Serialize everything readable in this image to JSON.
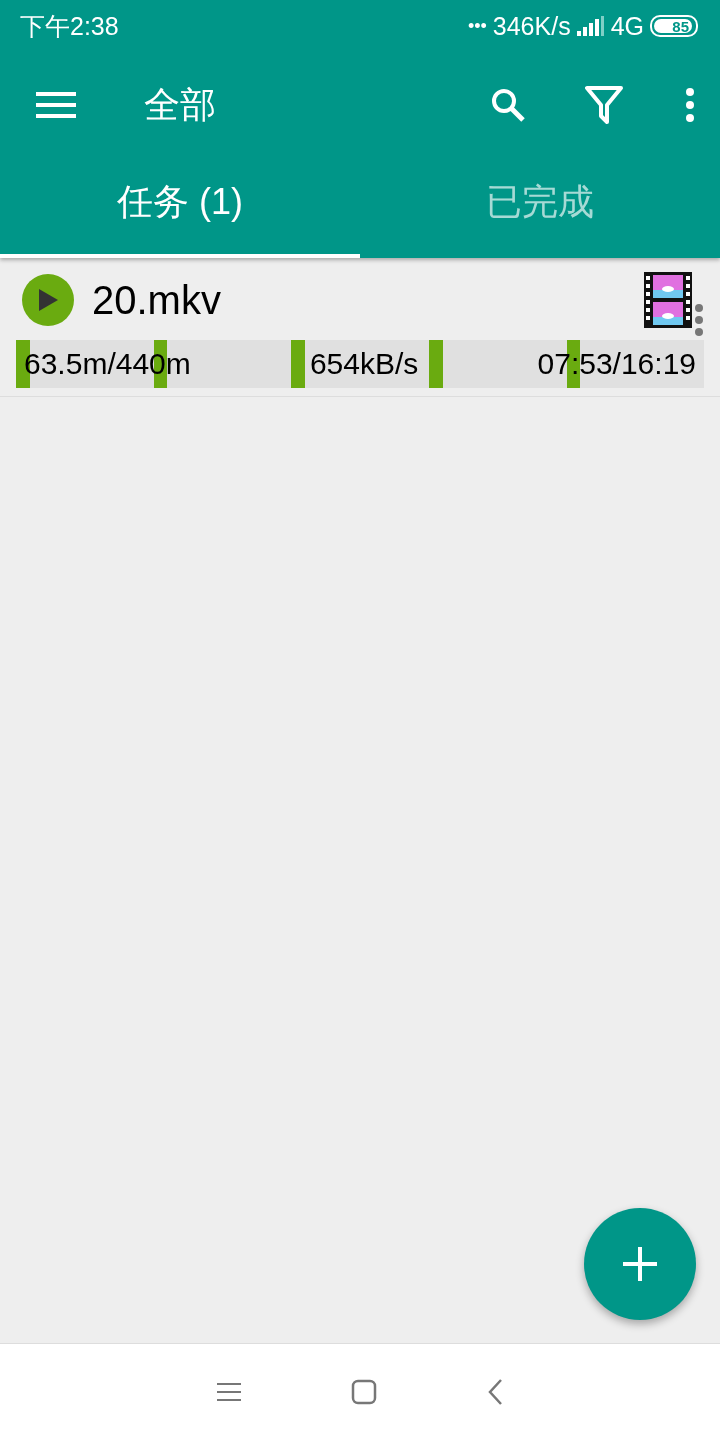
{
  "status_bar": {
    "time": "下午2:38",
    "more": "•••",
    "speed": "346K/s",
    "network": "4G",
    "battery": "85"
  },
  "toolbar": {
    "title": "全部"
  },
  "tabs": [
    {
      "label": "任务 (1)",
      "selected": true
    },
    {
      "label": "已完成",
      "selected": false
    }
  ],
  "tasks": [
    {
      "name": "20.mkv",
      "playing": false,
      "size": "63.5m/440m",
      "rate": "654kB/s",
      "time": "07:53/16:19",
      "pieces": [
        true,
        false,
        false,
        false,
        false,
        false,
        false,
        false,
        false,
        false,
        true,
        false,
        false,
        false,
        false,
        false,
        false,
        false,
        false,
        false,
        true,
        false,
        false,
        false,
        false,
        false,
        false,
        false,
        false,
        false,
        true,
        false,
        false,
        false,
        false,
        false,
        false,
        false,
        false,
        false,
        true,
        false,
        false,
        false,
        false,
        false,
        false,
        false,
        false,
        false
      ]
    }
  ]
}
